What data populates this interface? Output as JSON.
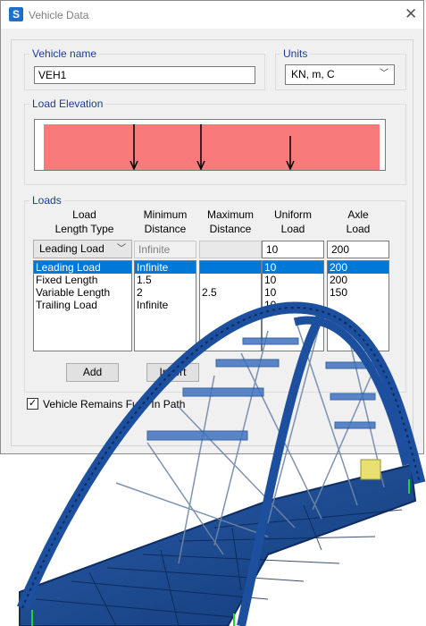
{
  "window": {
    "title": "Vehicle Data",
    "app_icon": "S"
  },
  "vehicle_name": {
    "label": "Vehicle name",
    "value": "VEH1"
  },
  "units": {
    "label": "Units",
    "selected": "KN, m, C"
  },
  "load_elevation": {
    "label": "Load Elevation",
    "fill_color": "#f87a7a"
  },
  "loads": {
    "label": "Loads",
    "headers": [
      [
        "Load",
        "Length Type"
      ],
      [
        "Minimum",
        "Distance"
      ],
      [
        "Maximum",
        "Distance"
      ],
      [
        "Uniform",
        "Load"
      ],
      [
        "Axle",
        "Load"
      ]
    ],
    "edit_row": {
      "length_type": "Leading Load",
      "min_distance": "Infinite",
      "max_distance": "",
      "uniform_load": "10",
      "axle_load": "200"
    },
    "rows": [
      {
        "length_type": "Leading Load",
        "min_distance": "Infinite",
        "max_distance": "",
        "uniform_load": "10",
        "axle_load": "200"
      },
      {
        "length_type": "Fixed Length",
        "min_distance": "1.5",
        "max_distance": "",
        "uniform_load": "10",
        "axle_load": "200"
      },
      {
        "length_type": "Variable Length",
        "min_distance": "2",
        "max_distance": "2.5",
        "uniform_load": "10",
        "axle_load": "150"
      },
      {
        "length_type": "Trailing Load",
        "min_distance": "Infinite",
        "max_distance": "",
        "uniform_load": "10",
        "axle_load": ""
      }
    ],
    "add_label": "Add",
    "insert_label": "Insert"
  },
  "remains_in_path": {
    "label": "Vehicle Remains Fully In Path",
    "checked": true
  },
  "colors": {
    "selection": "#0078d7",
    "group_label": "#1a3e8c",
    "bridge": "#1f4f9c"
  }
}
